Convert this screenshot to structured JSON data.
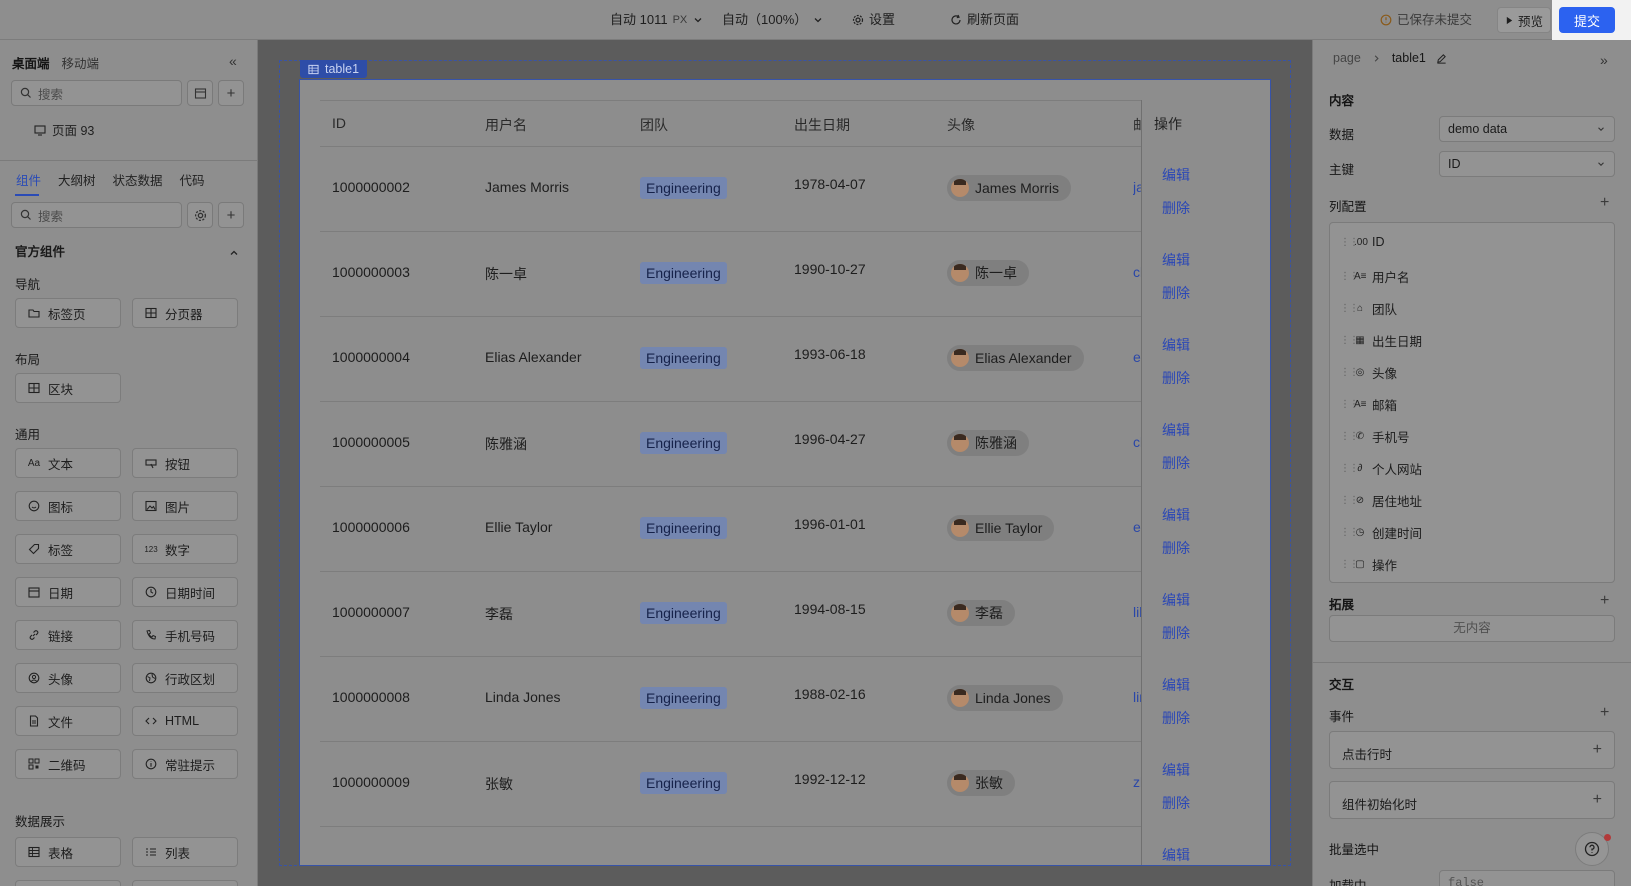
{
  "topbar": {
    "width_mode": "自动 1011",
    "width_unit": "PX",
    "zoom": "自动（100%）",
    "settings": "设置",
    "refresh": "刷新页面",
    "saved_status": "已保存未提交",
    "preview": "预览",
    "submit": "提交"
  },
  "left": {
    "tabs_top": [
      "桌面端",
      "移动端"
    ],
    "search_placeholder": "搜索",
    "page_item": "页面 93",
    "tabs": [
      "组件",
      "大纲树",
      "状态数据",
      "代码"
    ],
    "comp_search_placeholder": "搜索",
    "official_title": "官方组件",
    "sections": {
      "nav": "导航",
      "layout": "布局",
      "general": "通用",
      "data": "数据展示"
    },
    "components": {
      "tabs": "标签页",
      "pager": "分页器",
      "block": "区块",
      "text": "文本",
      "button": "按钮",
      "icon": "图标",
      "image": "图片",
      "tag": "标签",
      "number": "数字",
      "date": "日期",
      "datetime": "日期时间",
      "link": "链接",
      "phone": "手机号码",
      "avatar": "头像",
      "region": "行政区划",
      "file": "文件",
      "html": "HTML",
      "qrcode": "二维码",
      "notice": "常驻提示",
      "table": "表格",
      "list": "列表"
    },
    "number_icon": "123"
  },
  "canvas": {
    "tag_label": "table1",
    "columns": [
      "ID",
      "用户名",
      "团队",
      "出生日期",
      "头像",
      "邮"
    ],
    "ops_header": "操作",
    "edit_label": "编辑",
    "delete_label": "删除",
    "rows": [
      {
        "id": "1000000002",
        "name": "James Morris",
        "team": "Engineering",
        "birth": "1978-04-07",
        "avatar_name": "James Morris",
        "email": "ja"
      },
      {
        "id": "1000000003",
        "name": "陈一卓",
        "team": "Engineering",
        "birth": "1990-10-27",
        "avatar_name": "陈一卓",
        "email": "cl"
      },
      {
        "id": "1000000004",
        "name": "Elias Alexander",
        "team": "Engineering",
        "birth": "1993-06-18",
        "avatar_name": "Elias Alexander",
        "email": "el"
      },
      {
        "id": "1000000005",
        "name": "陈雅涵",
        "team": "Engineering",
        "birth": "1996-04-27",
        "avatar_name": "陈雅涵",
        "email": "cl"
      },
      {
        "id": "1000000006",
        "name": "Ellie Taylor",
        "team": "Engineering",
        "birth": "1996-01-01",
        "avatar_name": "Ellie Taylor",
        "email": "el"
      },
      {
        "id": "1000000007",
        "name": "李磊",
        "team": "Engineering",
        "birth": "1994-08-15",
        "avatar_name": "李磊",
        "email": "lil"
      },
      {
        "id": "1000000008",
        "name": "Linda Jones",
        "team": "Engineering",
        "birth": "1988-02-16",
        "avatar_name": "Linda Jones",
        "email": "lir"
      },
      {
        "id": "1000000009",
        "name": "张敏",
        "team": "Engineering",
        "birth": "1992-12-12",
        "avatar_name": "张敏",
        "email": "zh"
      }
    ]
  },
  "right": {
    "breadcrumb_page": "page",
    "breadcrumb_current": "table1",
    "content_title": "内容",
    "data_label": "数据",
    "data_value": "demo data",
    "key_label": "主键",
    "key_value": "ID",
    "col_config_label": "列配置",
    "columns": [
      {
        "icon": ".00",
        "label": "ID"
      },
      {
        "icon": "A≡",
        "label": "用户名"
      },
      {
        "icon": "⌂",
        "label": "团队"
      },
      {
        "icon": "▦",
        "label": "出生日期"
      },
      {
        "icon": "◎",
        "label": "头像"
      },
      {
        "icon": "A≡",
        "label": "邮箱"
      },
      {
        "icon": "✆",
        "label": "手机号"
      },
      {
        "icon": "∂",
        "label": "个人网站"
      },
      {
        "icon": "⊘",
        "label": "居住地址"
      },
      {
        "icon": "◷",
        "label": "创建时间"
      },
      {
        "icon": "▢",
        "label": "操作"
      }
    ],
    "extend_label": "拓展",
    "empty_text": "无内容",
    "interaction_title": "交互",
    "events_label": "事件",
    "event_row_click": "点击行时",
    "event_init": "组件初始化时",
    "batch_select": "批量选中",
    "loading_label": "加载中",
    "loading_value": "false"
  }
}
